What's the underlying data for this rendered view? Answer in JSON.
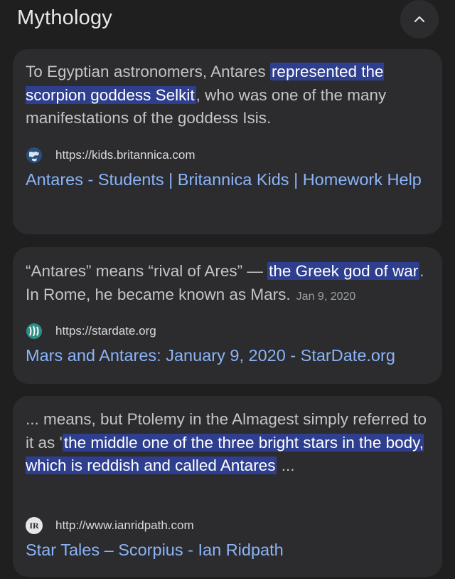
{
  "section": {
    "title": "Mythology",
    "collapse_icon": "chevron-up-icon"
  },
  "results": [
    {
      "snippet": [
        {
          "text": "To Egyptian astronomers, Antares ",
          "hl": false
        },
        {
          "text": "represented the scorpion goddess Selkit",
          "hl": true
        },
        {
          "text": ", who was one of the many manifestations of the goddess Isis.",
          "hl": false
        }
      ],
      "date": "",
      "url": "https://kids.britannica.com",
      "favicon": "globe-icon",
      "link": "Antares - Students | Britannica Kids | Homework Help"
    },
    {
      "snippet": [
        {
          "text": "“Antares” means “rival of Ares” — ",
          "hl": false
        },
        {
          "text": "the Greek god of war",
          "hl": true
        },
        {
          "text": ". In Rome, he became known as Mars.",
          "hl": false
        }
      ],
      "date": "Jan 9, 2020",
      "url": "https://stardate.org",
      "favicon": "stardate-logo-icon",
      "link": "Mars and Antares: January 9, 2020 - StarDate.org"
    },
    {
      "snippet": [
        {
          "text": "... means, but Ptolemy in the Almagest simply referred to it as '",
          "hl": false
        },
        {
          "text": "the middle one of the three bright stars in the body, which is reddish and called Antares",
          "hl": true
        },
        {
          "text": " ...",
          "hl": false
        }
      ],
      "date": "",
      "url": "http://www.ianridpath.com",
      "favicon": "ir-logo-icon",
      "favicon_text": "IR",
      "link": "Star Tales – Scorpius - Ian Ridpath"
    }
  ],
  "colors": {
    "background": "#1f1f1f",
    "card": "#2c2c2f",
    "highlight": "#2f3f8f",
    "link": "#8ab4f8"
  }
}
